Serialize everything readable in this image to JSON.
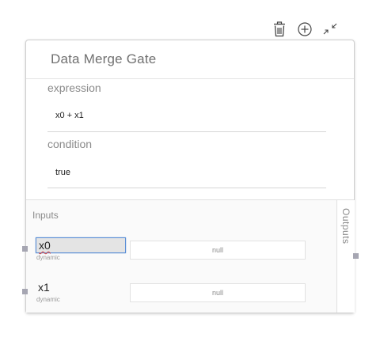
{
  "toolbar": {
    "delete_icon": "trash-icon",
    "add_icon": "plus-circle-icon",
    "collapse_icon": "collapse-arrows-icon"
  },
  "node": {
    "title": "Data Merge Gate",
    "fields": [
      {
        "label": "expression",
        "value": "x0 + x1"
      },
      {
        "label": "condition",
        "value": "true"
      }
    ],
    "inputs_label": "Inputs",
    "outputs_label": "Outputs",
    "inputs": [
      {
        "name": "x0",
        "kind": "dynamic",
        "default": "null"
      },
      {
        "name": "x1",
        "kind": "dynamic",
        "default": "null"
      }
    ]
  },
  "colors": {
    "accent_focus": "#5b8fd6",
    "port_handle": "#a6a6b2",
    "node_border": "#cfcfcf"
  }
}
